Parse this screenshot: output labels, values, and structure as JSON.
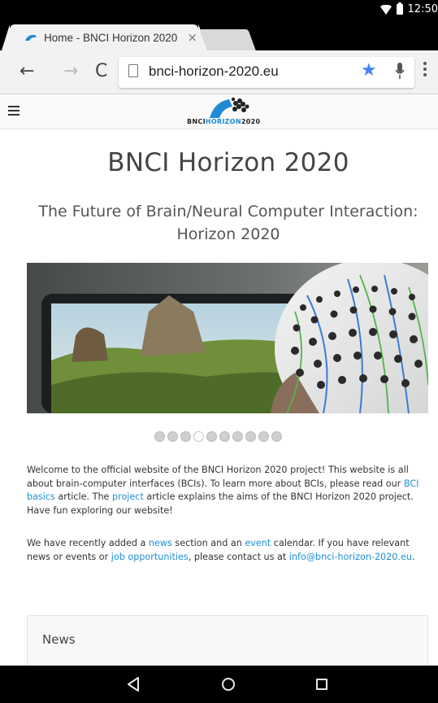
{
  "status_bar": {
    "time": "12:50"
  },
  "tab": {
    "title": "Home - BNCI Horizon 2020",
    "close": "×"
  },
  "toolbar": {
    "url": "bnci-horizon-2020.eu"
  },
  "site": {
    "logo_text_parts": [
      "BNCI",
      "HORIZON",
      "2020"
    ],
    "title": "BNCI Horizon 2020",
    "subtitle": "The Future of Brain/Neural Computer Interaction: Horizon 2020"
  },
  "carousel": {
    "count": 10,
    "active_index": 3
  },
  "intro": {
    "p1_a": "Welcome to the official website of the BNCI Horizon 2020 project! This website is all about brain-computer interfaces (BCIs). To learn more about BCIs, please read our ",
    "p1_link1": "BCI basics",
    "p1_b": " article. The ",
    "p1_link2": "project",
    "p1_c": " article explains the aims of the BNCI Horizon 2020 project. Have fun exploring our website!",
    "p2_a": "We have recently added a ",
    "p2_link1": "news",
    "p2_b": " section and an ",
    "p2_link2": "event",
    "p2_c": " calendar. If you have relevant news or events or ",
    "p2_link3": "job opportunities",
    "p2_d": ", please contact us at ",
    "p2_link4": "info@bnci-horizon-2020.eu",
    "p2_e": "."
  },
  "news": {
    "title": "News"
  },
  "colors": {
    "link": "#1e90d6",
    "star": "#4285f4",
    "logo_blue": "#1f8ad4"
  }
}
